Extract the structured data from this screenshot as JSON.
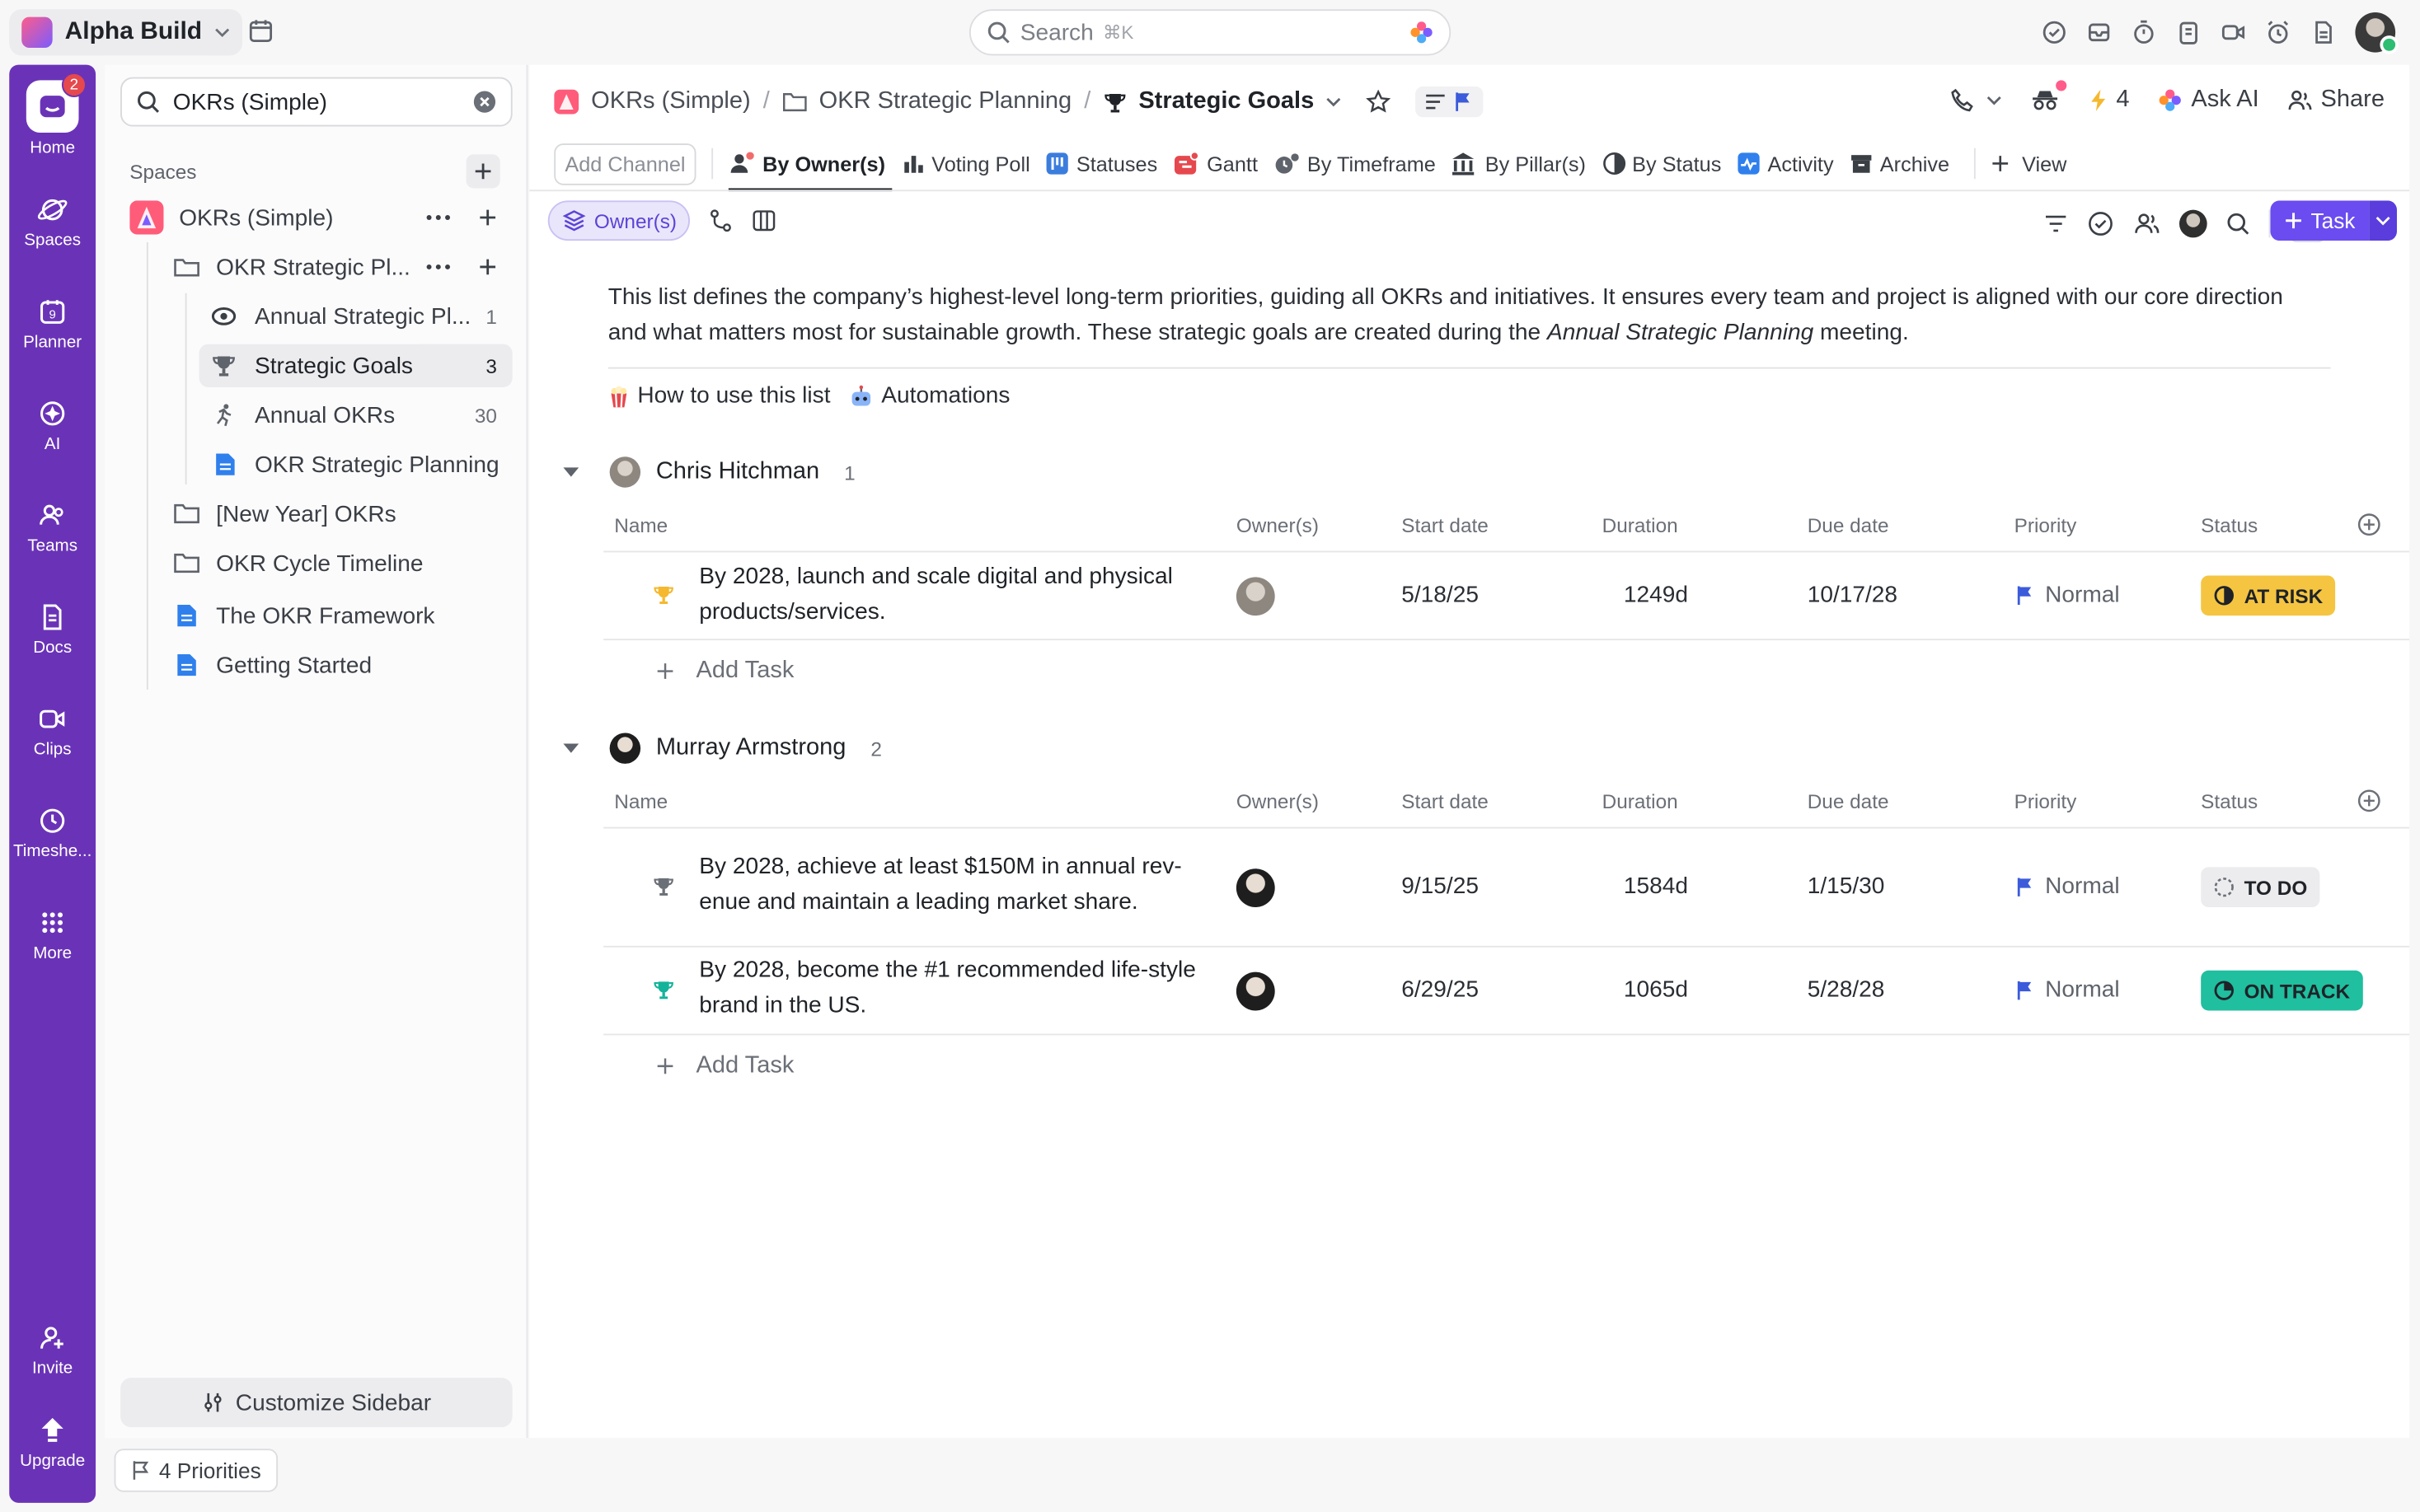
{
  "workspace": {
    "name": "Alpha Build"
  },
  "search": {
    "placeholder": "Search",
    "shortcut": "⌘K"
  },
  "rail": {
    "home_badge": "2",
    "items": [
      {
        "label": "Home",
        "icon": "home-icon"
      },
      {
        "label": "Spaces",
        "icon": "spaces-icon"
      },
      {
        "label": "Planner",
        "icon": "planner-icon"
      },
      {
        "label": "AI",
        "icon": "ai-icon"
      },
      {
        "label": "Teams",
        "icon": "teams-icon"
      },
      {
        "label": "Docs",
        "icon": "docs-icon"
      },
      {
        "label": "Clips",
        "icon": "clips-icon"
      },
      {
        "label": "Timeshe...",
        "icon": "clock-icon"
      },
      {
        "label": "More",
        "icon": "grid-icon"
      },
      {
        "label": "Invite",
        "icon": "invite-icon"
      },
      {
        "label": "Upgrade",
        "icon": "upgrade-icon"
      }
    ],
    "planner_day": "9"
  },
  "sidebar": {
    "search_value": "OKRs (Simple)",
    "spaces_heading": "Spaces",
    "tree": [
      {
        "label": "OKRs (Simple)",
        "icon": "space-icon",
        "count": ""
      },
      {
        "label": "OKR Strategic Pl...",
        "icon": "folder-open-icon",
        "count": ""
      },
      {
        "label": "Annual Strategic Pl...",
        "icon": "eye-icon",
        "count": "1"
      },
      {
        "label": "Strategic Goals",
        "icon": "trophy-icon",
        "count": "3"
      },
      {
        "label": "Annual OKRs",
        "icon": "runner-icon",
        "count": "30"
      },
      {
        "label": "OKR Strategic Planning",
        "icon": "doc-icon",
        "count": ""
      },
      {
        "label": "[New Year] OKRs",
        "icon": "folder-icon",
        "count": ""
      },
      {
        "label": "OKR Cycle Timeline",
        "icon": "folder-icon",
        "count": ""
      },
      {
        "label": "The OKR Framework",
        "icon": "doc-icon",
        "count": ""
      },
      {
        "label": "Getting Started",
        "icon": "doc-icon",
        "count": ""
      }
    ],
    "customize_label": "Customize Sidebar"
  },
  "bottom": {
    "priorities_label": "4 Priorities"
  },
  "breadcrumb": {
    "items": [
      "OKRs (Simple)",
      "OKR Strategic Planning",
      "Strategic Goals"
    ]
  },
  "header_actions": {
    "notify_count": "4",
    "ask_ai": "Ask AI",
    "share": "Share"
  },
  "tabs": {
    "add_channel": "Add Channel",
    "items": [
      "By Owner(s)",
      "Voting Poll",
      "Statuses",
      "Gantt",
      "By Timeframe",
      "By Pillar(s)",
      "By Status",
      "Activity",
      "Archive"
    ],
    "add_view": "View"
  },
  "toolbar": {
    "group_chip": "Owner(s)",
    "task_button": "Task"
  },
  "description": {
    "text_before": "This list defines the company’s highest-level long-term priorities, guiding all OKRs and initiatives. It ensures every team and project is aligned with our core direction and what matters most for sustainable growth. These strategic goals are created during the ",
    "text_emph": "Annual Strategic Planning",
    "text_after": " meeting.",
    "link1": "How to use this list",
    "link2": "Automations"
  },
  "columns": [
    "Name",
    "Owner(s)",
    "Start date",
    "Duration",
    "Due date",
    "Priority",
    "Status"
  ],
  "groups": [
    {
      "owner": "Chris Hitchman",
      "count": "1",
      "tasks": [
        {
          "name": "By 2028, launch and scale digital and physical products/services.",
          "start": "5/18/25",
          "duration": "1249d",
          "due": "10/17/28",
          "priority": "Normal",
          "status": "AT RISK",
          "status_color": "#f5c542",
          "trophy_color": "#f5b82e"
        }
      ],
      "add_task": "Add Task"
    },
    {
      "owner": "Murray Armstrong",
      "count": "2",
      "tasks": [
        {
          "name": "By 2028, achieve at least $150M in annual rev-enue and maintain a leading market share.",
          "start": "9/15/25",
          "duration": "1584d",
          "due": "1/15/30",
          "priority": "Normal",
          "status": "TO DO",
          "status_color": "#ececee",
          "trophy_color": "#6b6f77"
        },
        {
          "name": "By 2028, become the #1 recommended life-style brand in the US.",
          "start": "6/29/25",
          "duration": "1065d",
          "due": "5/28/28",
          "priority": "Normal",
          "status": "ON TRACK",
          "status_color": "#1fbf9f",
          "trophy_color": "#12b39a"
        }
      ],
      "add_task": "Add Task"
    }
  ],
  "colors": {
    "accent": "#6a4cf0",
    "rail": "#6a33b7",
    "flag": "#3b5bdb"
  }
}
